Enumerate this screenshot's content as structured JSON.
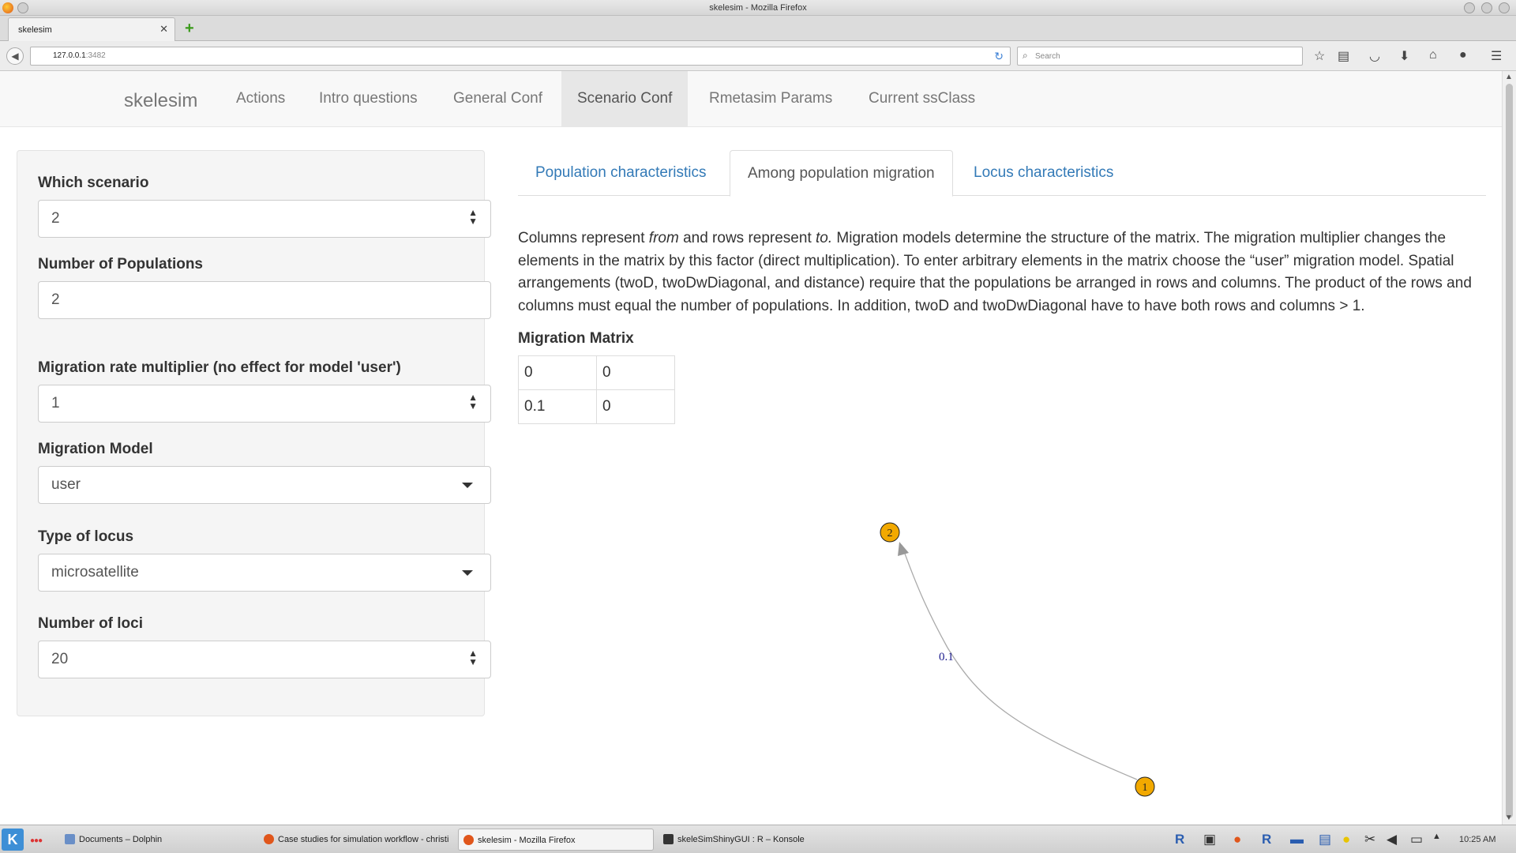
{
  "window": {
    "title": "skelesim - Mozilla Firefox"
  },
  "browser": {
    "tab_title": "skelesim",
    "url_host": "127.0.0.1",
    "url_port": ":3482",
    "search_placeholder": "Search"
  },
  "app": {
    "brand": "skelesim",
    "nav": [
      "Actions",
      "Intro questions",
      "General Conf",
      "Scenario Conf",
      "Rmetasim Params",
      "Current ssClass"
    ],
    "active_nav": "Scenario Conf"
  },
  "sidebar": {
    "which_scenario": {
      "label": "Which scenario",
      "value": "2"
    },
    "num_pops": {
      "label": "Number of Populations",
      "value": "2"
    },
    "mig_mult": {
      "label": "Migration rate multiplier (no effect for model 'user')",
      "value": "1"
    },
    "mig_model": {
      "label": "Migration Model",
      "value": "user"
    },
    "locus_type": {
      "label": "Type of locus",
      "value": "microsatellite"
    },
    "num_loci": {
      "label": "Number of loci",
      "value": "20"
    }
  },
  "panel": {
    "tabs": [
      "Population characteristics",
      "Among population migration",
      "Locus characteristics"
    ],
    "active_tab": "Among population migration",
    "desc": {
      "p1": "Columns represent ",
      "from": "from",
      "p2": " and rows represent ",
      "to": "to.",
      "p3": " Migration models determine the structure of the matrix. The migration multiplier changes the elements in the matrix by this factor (direct multiplication). To enter arbitrary elements in the matrix choose the “user” migration model. Spatial arrangements (twoD, twoDwDiagonal, and distance) require that the populations be arranged in rows and columns. The product of the rows and columns must equal the number of populations. In addition, twoD and twoDwDiagonal have to have both rows and columns > 1."
    },
    "matrix_title": "Migration Matrix",
    "matrix": [
      [
        "0",
        "0"
      ],
      [
        "0.1",
        "0"
      ]
    ]
  },
  "graph": {
    "nodes": [
      "1",
      "2"
    ],
    "edge_label": "0.1",
    "node_color": "#f2a900"
  },
  "taskbar": {
    "tasks": [
      "Documents – Dolphin",
      "Case studies for simulation workflow - christian",
      "skelesim - Mozilla Firefox",
      "skeleSimShinyGUI : R – Konsole"
    ],
    "clock": "10:25 AM"
  }
}
